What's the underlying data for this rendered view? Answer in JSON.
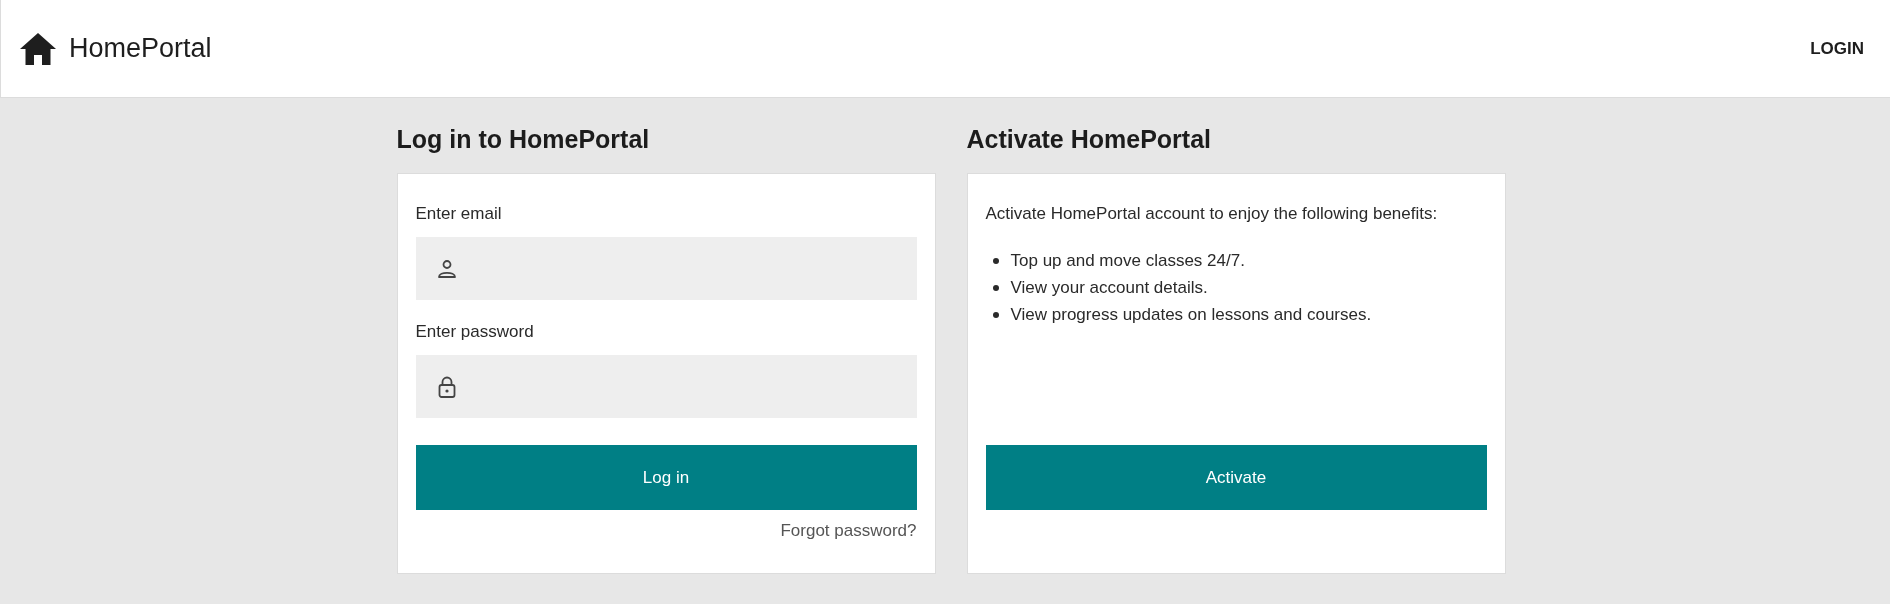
{
  "header": {
    "brand": "HomePortal",
    "nav": [
      {
        "label": "LOGIN"
      }
    ]
  },
  "login_panel": {
    "title": "Log in to HomePortal",
    "fields": [
      {
        "label": "Enter email",
        "kind": "email"
      },
      {
        "label": "Enter password",
        "kind": "password"
      }
    ],
    "submit": "Log in",
    "forgot_link": "Forgot password?"
  },
  "activate_panel": {
    "title": "Activate HomePortal",
    "intro": "Activate HomePortal account to enjoy the following benefits:",
    "benefits": [
      "Top up and move classes 24/7.",
      "View your account details.",
      "View progress updates on lessons and courses."
    ],
    "button": "Activate"
  }
}
